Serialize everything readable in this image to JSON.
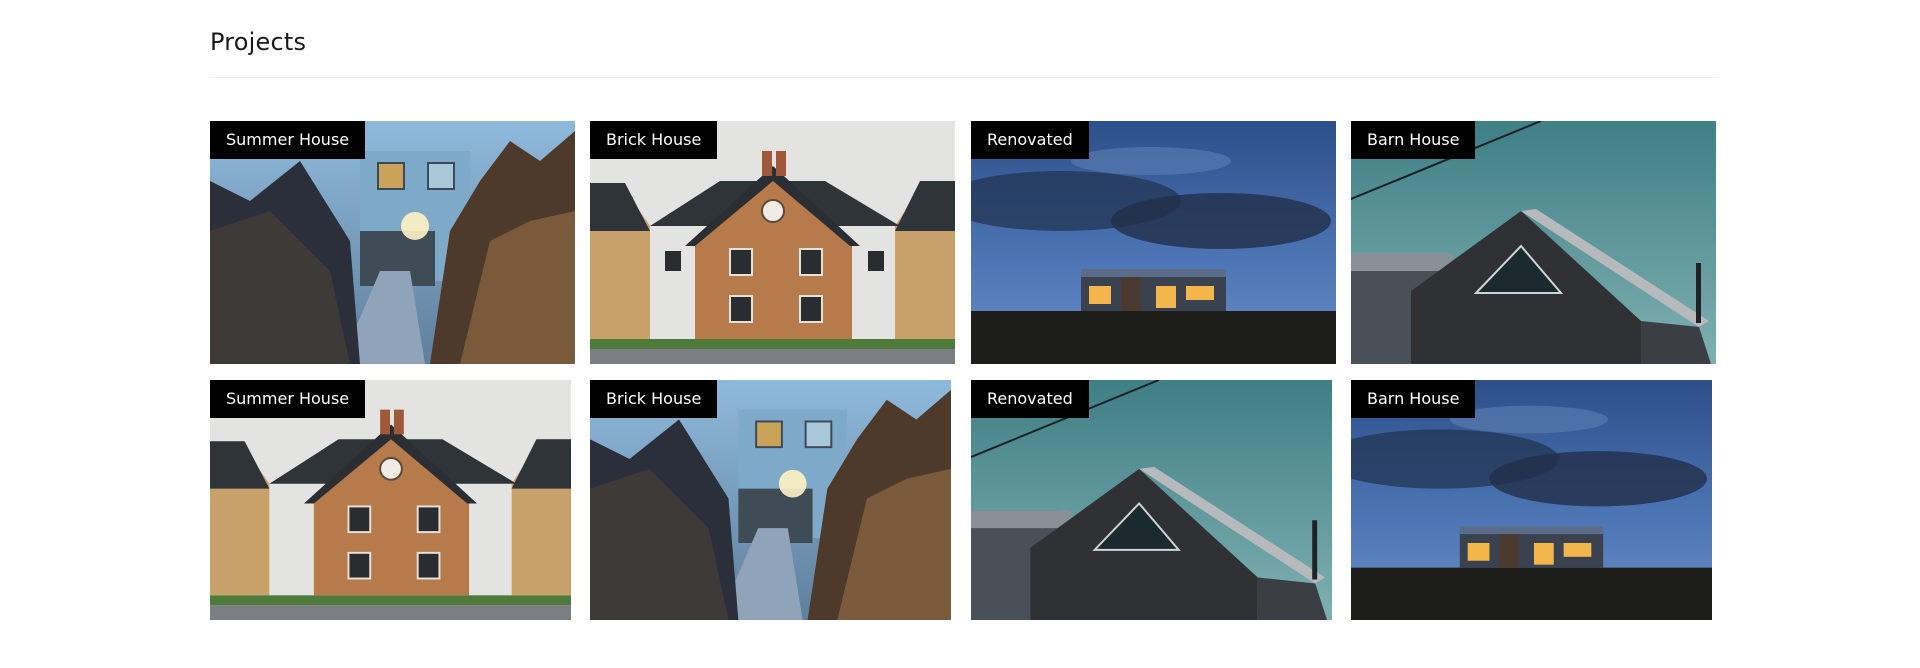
{
  "page": {
    "title": "Projects"
  },
  "projects": [
    {
      "label": "Summer House",
      "scene": "summer"
    },
    {
      "label": "Brick House",
      "scene": "brick"
    },
    {
      "label": "Renovated",
      "scene": "renovated"
    },
    {
      "label": "Barn House",
      "scene": "barn"
    },
    {
      "label": "Summer House",
      "scene": "brick"
    },
    {
      "label": "Brick House",
      "scene": "summer"
    },
    {
      "label": "Renovated",
      "scene": "barn"
    },
    {
      "label": "Barn House",
      "scene": "renovated"
    }
  ]
}
